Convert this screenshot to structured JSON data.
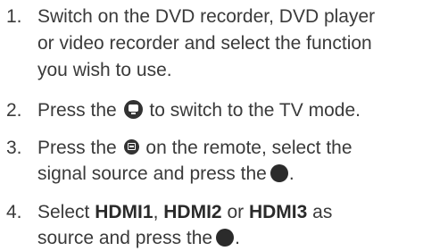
{
  "steps": [
    {
      "number": "1.",
      "line1": "Switch on the DVD recorder, DVD player",
      "line2": "or video recorder and select the function",
      "line3": "you wish to use."
    },
    {
      "number": "2.",
      "before": "Press the",
      "icon": "tv-mode-icon",
      "after": "to switch to the TV mode."
    },
    {
      "number": "3.",
      "before": "Press the",
      "icon": "source-icon",
      "after": "on the remote, select the",
      "line2_before": "signal source and press the",
      "line2_icon": "ok-button-icon",
      "line2_after": "."
    },
    {
      "number": "4.",
      "before": "Select",
      "opt1": "HDMI1",
      "sep1": ",",
      "opt2": "HDMI2",
      "sep2": "or",
      "opt3": "HDMI3",
      "after": "as",
      "line2_before": "source and press the",
      "line2_icon": "ok-button-icon",
      "line2_after": "."
    }
  ]
}
